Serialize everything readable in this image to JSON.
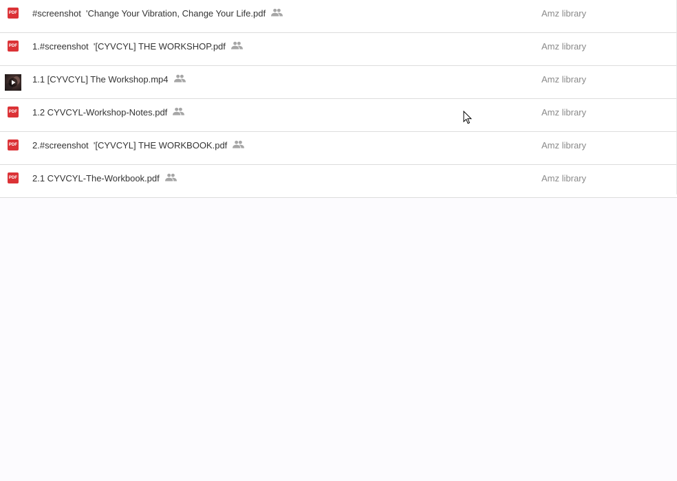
{
  "files": [
    {
      "type": "pdf",
      "icon": "pdf-icon",
      "icon_label": "PDF",
      "name": "#screenshot  'Change Your Vibration, Change Your Life.pdf",
      "shared": true,
      "owner": "Amz library"
    },
    {
      "type": "pdf",
      "icon": "pdf-icon",
      "icon_label": "PDF",
      "name": "1.#screenshot  '[CYVCYL] THE WORKSHOP.pdf",
      "shared": true,
      "owner": "Amz library"
    },
    {
      "type": "video",
      "icon": "video-thumbnail",
      "icon_label": "",
      "name": "1.1 [CYVCYL] The Workshop.mp4",
      "shared": true,
      "owner": "Amz library"
    },
    {
      "type": "pdf",
      "icon": "pdf-icon",
      "icon_label": "PDF",
      "name": "1.2 CYVCYL-Workshop-Notes.pdf",
      "shared": true,
      "owner": "Amz library"
    },
    {
      "type": "pdf",
      "icon": "pdf-icon",
      "icon_label": "PDF",
      "name": "2.#screenshot  '[CYVCYL] THE WORKBOOK.pdf",
      "shared": true,
      "owner": "Amz library"
    },
    {
      "type": "pdf",
      "icon": "pdf-icon",
      "icon_label": "PDF",
      "name": "2.1 CYVCYL-The-Workbook.pdf",
      "shared": true,
      "owner": "Amz library"
    }
  ],
  "colors": {
    "pdf_red": "#db3236",
    "row_border": "#dcdcdc",
    "owner_text": "#8a8a8a",
    "name_text": "#333333",
    "background": "#fcfbfe"
  }
}
